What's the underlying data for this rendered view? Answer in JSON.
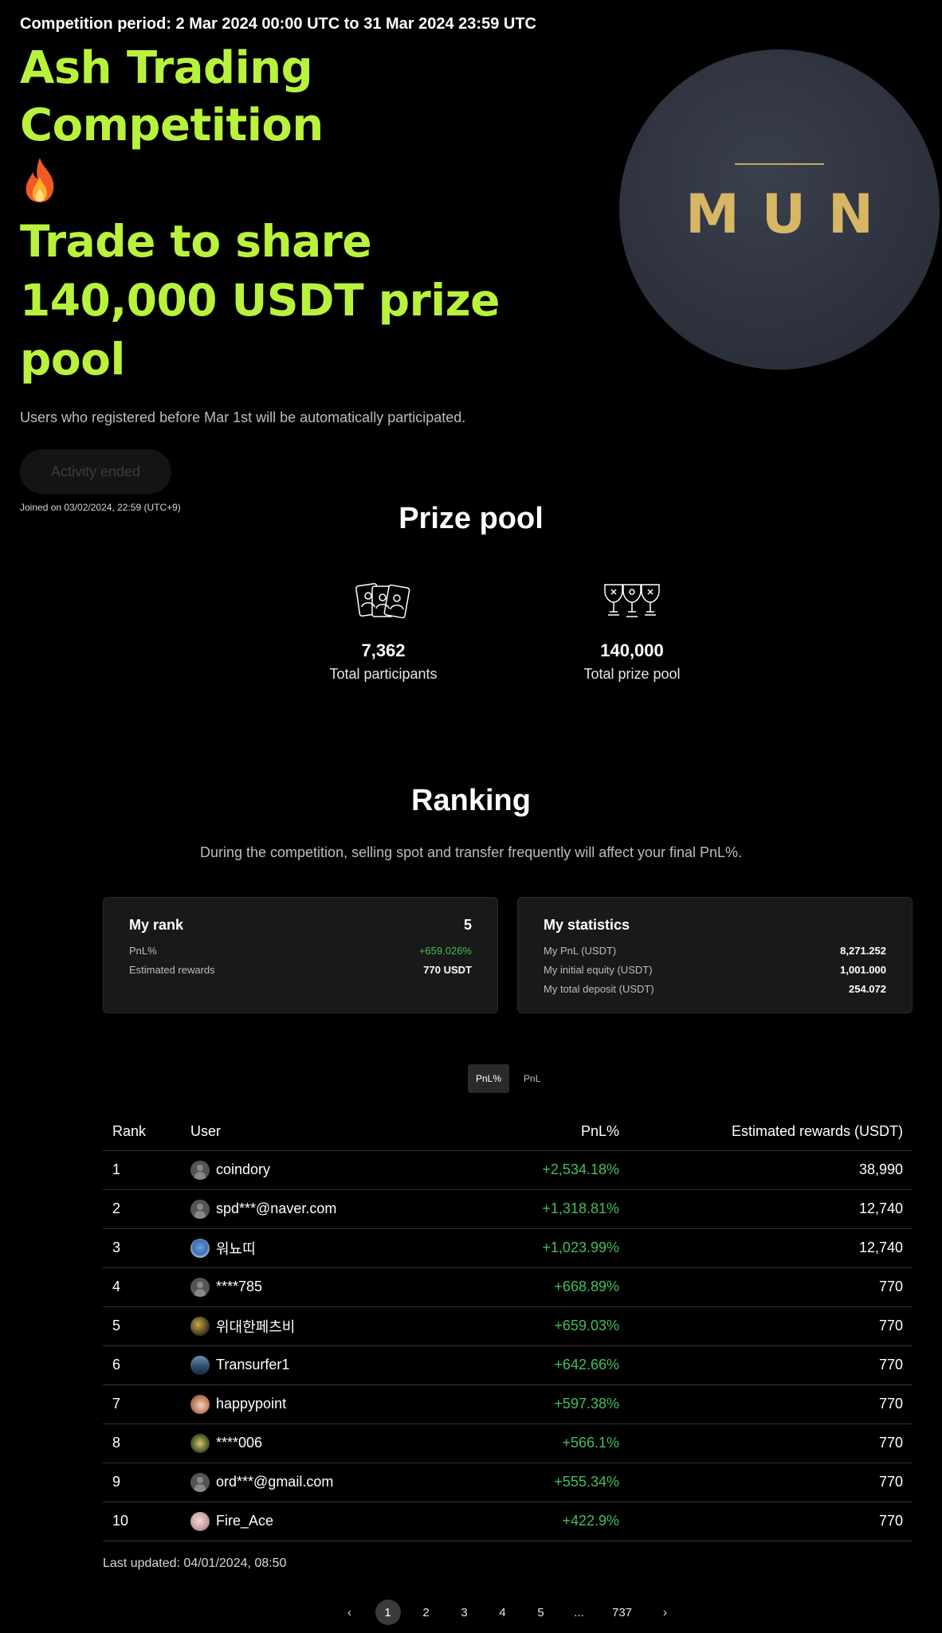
{
  "hero": {
    "period": "Competition period: 2 Mar 2024 00:00 UTC to 31 Mar 2024 23:59 UTC",
    "title": "Ash Trading Competition",
    "subtitle": "Trade to share 140,000 USDT prize pool",
    "note": "Users who registered before Mar 1st will be automatically participated.",
    "button_label": "Activity ended",
    "joined": "Joined on 03/02/2024, 22:59 (UTC+9)",
    "coin_text": "MUN"
  },
  "prize_pool": {
    "title": "Prize pool",
    "participants_value": "7,362",
    "participants_label": "Total participants",
    "pool_value": "140,000",
    "pool_label": "Total prize pool"
  },
  "ranking": {
    "title": "Ranking",
    "description": "During the competition, selling spot and transfer frequently will affect your final PnL%.",
    "my_rank": {
      "title": "My rank",
      "rank": "5",
      "pnl_label": "PnL%",
      "pnl_value": "+659.026%",
      "rewards_label": "Estimated rewards",
      "rewards_value": "770 USDT"
    },
    "my_stats": {
      "title": "My statistics",
      "pnl_label": "My PnL (USDT)",
      "pnl_value": "8,271.252",
      "equity_label": "My initial equity (USDT)",
      "equity_value": "1,001.000",
      "deposit_label": "My total deposit (USDT)",
      "deposit_value": "254.072"
    },
    "toggle": [
      "PnL%",
      "PnL"
    ],
    "columns": [
      "Rank",
      "User",
      "PnL%",
      "Estimated rewards (USDT)"
    ],
    "rows": [
      {
        "rank": "1",
        "user": "coindory",
        "pnl": "+2,534.18%",
        "reward": "38,990"
      },
      {
        "rank": "2",
        "user": "spd***@naver.com",
        "pnl": "+1,318.81%",
        "reward": "12,740"
      },
      {
        "rank": "3",
        "user": "워뇨띠",
        "pnl": "+1,023.99%",
        "reward": "12,740"
      },
      {
        "rank": "4",
        "user": "****785",
        "pnl": "+668.89%",
        "reward": "770"
      },
      {
        "rank": "5",
        "user": "위대한페츠비",
        "pnl": "+659.03%",
        "reward": "770"
      },
      {
        "rank": "6",
        "user": "Transurfer1",
        "pnl": "+642.66%",
        "reward": "770"
      },
      {
        "rank": "7",
        "user": "happypoint",
        "pnl": "+597.38%",
        "reward": "770"
      },
      {
        "rank": "8",
        "user": "****006",
        "pnl": "+566.1%",
        "reward": "770"
      },
      {
        "rank": "9",
        "user": "ord***@gmail.com",
        "pnl": "+555.34%",
        "reward": "770"
      },
      {
        "rank": "10",
        "user": "Fire_Ace",
        "pnl": "+422.9%",
        "reward": "770"
      }
    ],
    "last_updated": "Last updated: 04/01/2024, 08:50"
  },
  "pagination": {
    "prev": "‹",
    "pages": [
      "1",
      "2",
      "3",
      "4",
      "5",
      "...",
      "737"
    ],
    "next": "›",
    "active": "1"
  },
  "colors": {
    "accent": "#b9f23d",
    "positive": "#3fbf5c",
    "background": "#000000",
    "card": "#191919"
  }
}
